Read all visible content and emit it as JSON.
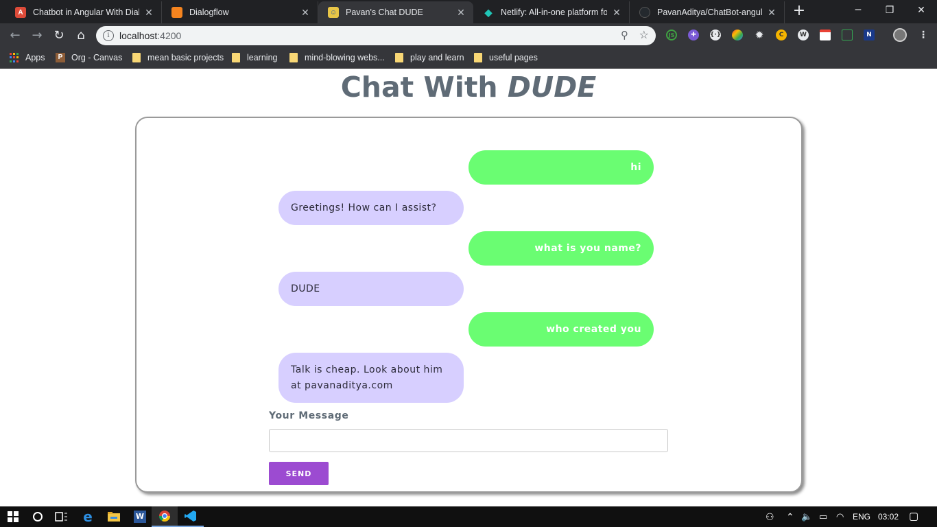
{
  "browser": {
    "tabs": [
      {
        "title": "Chatbot in Angular With Dialogflow",
        "favicon": "angular-icon",
        "color": "#dd4b39"
      },
      {
        "title": "Dialogflow",
        "favicon": "dialogflow-icon",
        "color": "#f5841f"
      },
      {
        "title": "Pavan's Chat DUDE",
        "favicon": "app-icon",
        "color": "#e8c547"
      },
      {
        "title": "Netlify: All-in-one platform for",
        "favicon": "netlify-icon",
        "color": "#20c6b7"
      },
      {
        "title": "PavanAditya/ChatBot-angular-",
        "favicon": "github-icon",
        "color": "#24292e"
      }
    ],
    "active_tab": 2,
    "url_host": "localhost",
    "url_port": ":4200",
    "bookmarks": [
      {
        "label": "Apps",
        "icon": "apps-grid-icon"
      },
      {
        "label": "Org - Canvas",
        "icon": "canvas-icon"
      },
      {
        "label": "mean basic projects",
        "icon": "folder-icon"
      },
      {
        "label": "learning",
        "icon": "folder-icon"
      },
      {
        "label": "mind-blowing webs...",
        "icon": "folder-icon"
      },
      {
        "label": "play and learn",
        "icon": "folder-icon"
      },
      {
        "label": "useful pages",
        "icon": "folder-icon"
      }
    ]
  },
  "page": {
    "title_prefix": "Chat With ",
    "title_emphasis": "DUDE",
    "messages": [
      {
        "sender": "user",
        "text": "hi"
      },
      {
        "sender": "bot",
        "text": "Greetings! How can I assist?"
      },
      {
        "sender": "user",
        "text": "what is you name?"
      },
      {
        "sender": "bot",
        "text": "DUDE"
      },
      {
        "sender": "user",
        "text": "who created you"
      },
      {
        "sender": "bot",
        "text": "Talk is cheap. Look about him at pavanaditya.com"
      }
    ],
    "input_label": "Your Message",
    "input_value": "",
    "send_label": "SEND",
    "colors": {
      "user_bubble": "#6afd72",
      "bot_bubble": "#d7cfff",
      "send_button": "#9c4bd1",
      "title": "#5f6b76"
    }
  },
  "taskbar": {
    "language": "ENG",
    "time": "03:02"
  }
}
